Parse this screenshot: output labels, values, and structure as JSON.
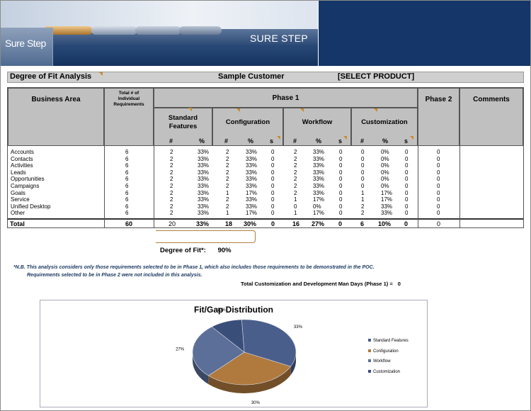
{
  "banner": {
    "logo_text": "Sure Step",
    "brand_text": "SURE STEP"
  },
  "titlebar": {
    "left": "Degree of Fit Analysis",
    "center": "Sample Customer",
    "right": "[SELECT PRODUCT]"
  },
  "table": {
    "headers": {
      "business_area": "Business Area",
      "total_req": "Total # of Individual Requirements",
      "phase1": "Phase 1",
      "phase2": "Phase 2",
      "comments": "Comments",
      "standard": "Standard Features",
      "configuration": "Configuration",
      "workflow": "Workflow",
      "customization": "Customization",
      "num": "#",
      "pct": "%",
      "s": "s"
    },
    "rows": [
      {
        "area": "Accounts",
        "total": "6",
        "sf_n": "2",
        "sf_p": "33%",
        "cf_n": "2",
        "cf_p": "33%",
        "cf_s": "0",
        "wf_n": "2",
        "wf_p": "33%",
        "wf_s": "0",
        "cu_n": "0",
        "cu_p": "0%",
        "cu_s": "0",
        "p2": "0"
      },
      {
        "area": "Contacts",
        "total": "6",
        "sf_n": "2",
        "sf_p": "33%",
        "cf_n": "2",
        "cf_p": "33%",
        "cf_s": "0",
        "wf_n": "2",
        "wf_p": "33%",
        "wf_s": "0",
        "cu_n": "0",
        "cu_p": "0%",
        "cu_s": "0",
        "p2": "0"
      },
      {
        "area": "Activities",
        "total": "6",
        "sf_n": "2",
        "sf_p": "33%",
        "cf_n": "2",
        "cf_p": "33%",
        "cf_s": "0",
        "wf_n": "2",
        "wf_p": "33%",
        "wf_s": "0",
        "cu_n": "0",
        "cu_p": "0%",
        "cu_s": "0",
        "p2": "0"
      },
      {
        "area": "Leads",
        "total": "6",
        "sf_n": "2",
        "sf_p": "33%",
        "cf_n": "2",
        "cf_p": "33%",
        "cf_s": "0",
        "wf_n": "2",
        "wf_p": "33%",
        "wf_s": "0",
        "cu_n": "0",
        "cu_p": "0%",
        "cu_s": "0",
        "p2": "0"
      },
      {
        "area": "Opportunities",
        "total": "6",
        "sf_n": "2",
        "sf_p": "33%",
        "cf_n": "2",
        "cf_p": "33%",
        "cf_s": "0",
        "wf_n": "2",
        "wf_p": "33%",
        "wf_s": "0",
        "cu_n": "0",
        "cu_p": "0%",
        "cu_s": "0",
        "p2": "0"
      },
      {
        "area": "Campaigns",
        "total": "6",
        "sf_n": "2",
        "sf_p": "33%",
        "cf_n": "2",
        "cf_p": "33%",
        "cf_s": "0",
        "wf_n": "2",
        "wf_p": "33%",
        "wf_s": "0",
        "cu_n": "0",
        "cu_p": "0%",
        "cu_s": "0",
        "p2": "0"
      },
      {
        "area": "Goals",
        "total": "6",
        "sf_n": "2",
        "sf_p": "33%",
        "cf_n": "1",
        "cf_p": "17%",
        "cf_s": "0",
        "wf_n": "2",
        "wf_p": "33%",
        "wf_s": "0",
        "cu_n": "1",
        "cu_p": "17%",
        "cu_s": "0",
        "p2": "0"
      },
      {
        "area": "Service",
        "total": "6",
        "sf_n": "2",
        "sf_p": "33%",
        "cf_n": "2",
        "cf_p": "33%",
        "cf_s": "0",
        "wf_n": "1",
        "wf_p": "17%",
        "wf_s": "0",
        "cu_n": "1",
        "cu_p": "17%",
        "cu_s": "0",
        "p2": "0"
      },
      {
        "area": "Unified Desktop",
        "total": "6",
        "sf_n": "2",
        "sf_p": "33%",
        "cf_n": "2",
        "cf_p": "33%",
        "cf_s": "0",
        "wf_n": "0",
        "wf_p": "0%",
        "wf_s": "0",
        "cu_n": "2",
        "cu_p": "33%",
        "cu_s": "0",
        "p2": "0"
      },
      {
        "area": "Other",
        "total": "6",
        "sf_n": "2",
        "sf_p": "33%",
        "cf_n": "1",
        "cf_p": "17%",
        "cf_s": "0",
        "wf_n": "1",
        "wf_p": "17%",
        "wf_s": "0",
        "cu_n": "2",
        "cu_p": "33%",
        "cu_s": "0",
        "p2": "0"
      }
    ],
    "total": {
      "label": "Total",
      "total": "60",
      "sf_n": "20",
      "sf_p": "33%",
      "cf_n": "18",
      "cf_p": "30%",
      "cf_s": "0",
      "wf_n": "16",
      "wf_p": "27%",
      "wf_s": "0",
      "cu_n": "6",
      "cu_p": "10%",
      "cu_s": "0",
      "p2": "0"
    }
  },
  "degree_of_fit": {
    "label": "Degree of Fit*:",
    "value": "90%"
  },
  "note": {
    "line1": "*N.B. This analysis considers only those requirements selected to be in Phase 1, which also includes those requirements to be demonstrated in the POC.",
    "line2": "Requirements selected to be in Phase 2 were not included in this analysis."
  },
  "mandays": {
    "label": "Total Customization and Development Man Days (Phase 1) =",
    "value": "0"
  },
  "chart_data": {
    "type": "pie",
    "title": "Fit/Gap Distribution",
    "categories": [
      "Standard Features",
      "Configuration",
      "Workflow",
      "Customization"
    ],
    "values": [
      33,
      30,
      27,
      10
    ],
    "labels": [
      "33%",
      "30%",
      "27%",
      "10%"
    ],
    "colors": [
      "#4a5e8c",
      "#b07a3e",
      "#5b6f99",
      "#3a4e7a"
    ],
    "legend_position": "right"
  }
}
